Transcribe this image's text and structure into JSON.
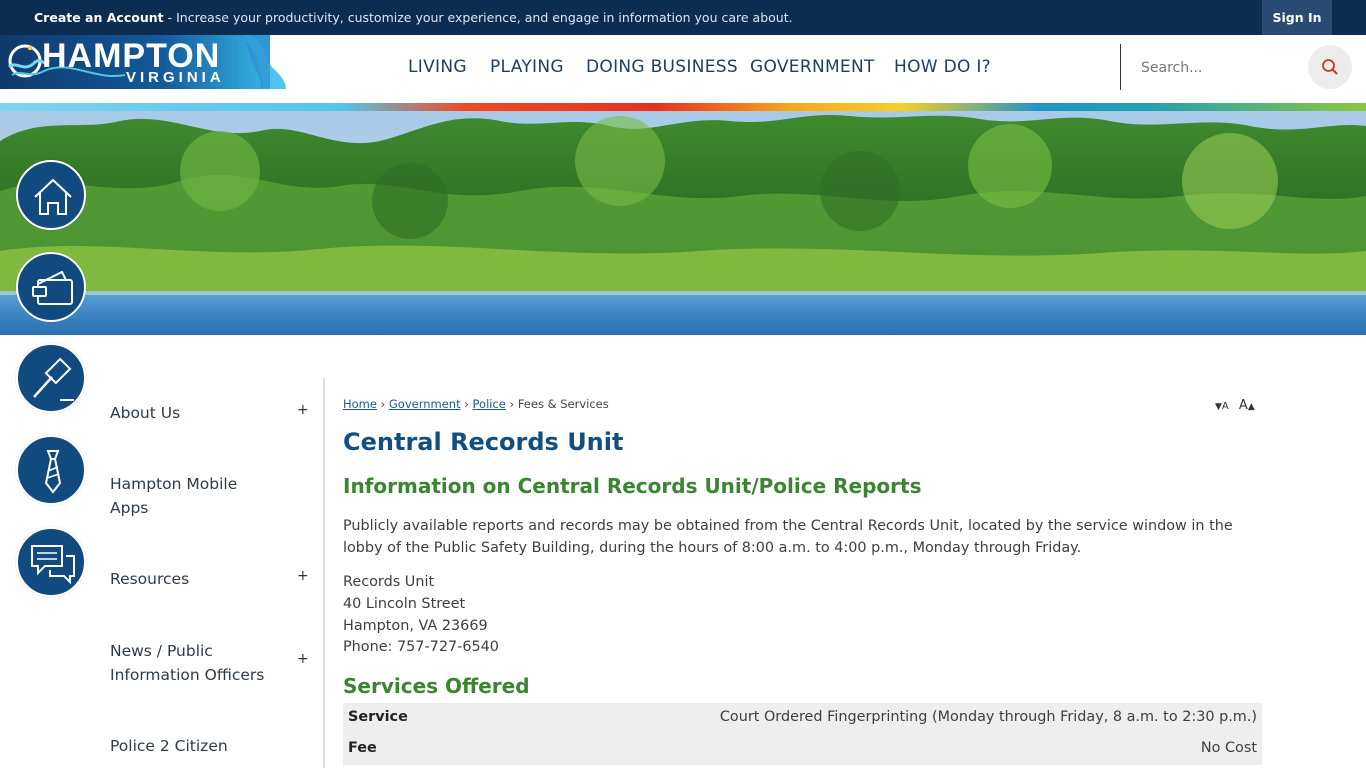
{
  "topbar": {
    "create_account": "Create an Account",
    "message": "- Increase your productivity, customize your experience, and engage in information you care about.",
    "sign_in": "Sign In"
  },
  "logo": {
    "name": "HAMPTON",
    "sub": "VIRGINIA"
  },
  "nav": {
    "items": [
      "LIVING",
      "PLAYING",
      "DOING BUSINESS",
      "GOVERNMENT",
      "HOW DO I?"
    ]
  },
  "search": {
    "placeholder": "Search..."
  },
  "quick_links": [
    {
      "icon": "home-icon"
    },
    {
      "icon": "wallet-icon"
    },
    {
      "icon": "gavel-icon"
    },
    {
      "icon": "necktie-icon"
    },
    {
      "icon": "chat-bubbles-icon"
    }
  ],
  "subnav": {
    "items": [
      {
        "label": "About Us",
        "expandable": true
      },
      {
        "label": "Hampton Mobile Apps",
        "expandable": false
      },
      {
        "label": "Resources",
        "expandable": true
      },
      {
        "label": "News / Public Information Officers",
        "expandable": true
      },
      {
        "label": "Police 2 Citizen",
        "expandable": false
      }
    ],
    "expand_symbol": "+"
  },
  "breadcrumb": {
    "home": "Home",
    "government": "Government",
    "police": "Police",
    "current": "Fees & Services",
    "separator": "›"
  },
  "font_controls": {
    "decrease": "A",
    "increase": "A"
  },
  "page": {
    "title": "Central Records Unit",
    "subtitle": "Information on Central Records Unit/Police Reports",
    "body": "Publicly available reports and records may be obtained from the Central Records Unit, located by the service window in the lobby of the Public Safety Building, during the hours of 8:00 a.m. to 4:00 p.m., Monday through Friday.",
    "address": {
      "line1": "Records Unit",
      "line2": "40 Lincoln Street",
      "line3": "Hampton, VA 23669",
      "phone": "Phone: 757-727-6540"
    },
    "services_heading": "Services Offered",
    "services": [
      {
        "label": "Service",
        "value": "Court Ordered Fingerprinting (Monday through Friday, 8 a.m. to 2:30 p.m.)"
      },
      {
        "label": "Fee",
        "value": "No Cost"
      }
    ]
  },
  "colors": {
    "topbar": "#0d2c52",
    "nav_text": "#1e3e66",
    "title": "#124f80",
    "heading_green": "#3b8431",
    "link": "#1d5896"
  }
}
